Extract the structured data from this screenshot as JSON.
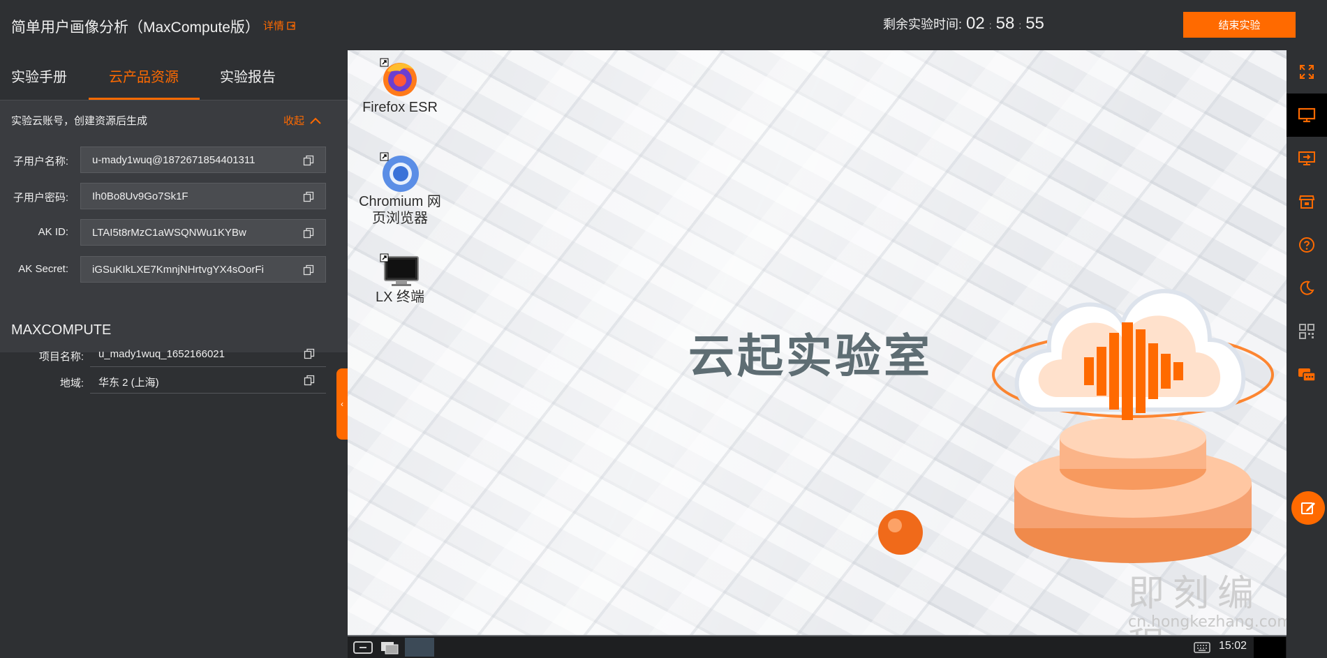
{
  "header": {
    "title": "简单用户画像分析（MaxCompute版）",
    "details_label": "详情",
    "timer_label": "剩余实验时间:",
    "timer_hours": "02",
    "timer_minutes": "58",
    "timer_seconds": "55",
    "timer_sep": ":",
    "end_button": "结束实验"
  },
  "tabs": [
    {
      "label": "实验手册",
      "active": false
    },
    {
      "label": "云产品资源",
      "active": true
    },
    {
      "label": "实验报告",
      "active": false
    }
  ],
  "account": {
    "heading": "实验云账号，创建资源后生成",
    "collapse_label": "收起",
    "fields": [
      {
        "label": "子用户名称:",
        "value": "u-mady1wuq@1872671854401311"
      },
      {
        "label": "子用户密码:",
        "value": "Ih0Bo8Uv9Go7Sk1F"
      },
      {
        "label": "AK ID:",
        "value": "LTAI5t8rMzC1aWSQNWu1KYBw"
      },
      {
        "label": "AK Secret:",
        "value": "iGSuKIkLXE7KmnjNHrtvgYX4sOorFi"
      }
    ]
  },
  "maxcompute": {
    "title": "MAXCOMPUTE",
    "fields": [
      {
        "label": "项目名称:",
        "value": "u_mady1wuq_1652166021"
      },
      {
        "label": "地域:",
        "value": "华东 2 (上海)"
      }
    ]
  },
  "desktop": {
    "icons": [
      {
        "label": "Firefox ESR",
        "icon": "firefox-icon"
      },
      {
        "label": "Chromium 网页浏览器",
        "icon": "chromium-icon"
      },
      {
        "label": "LX 终端",
        "icon": "terminal-icon"
      }
    ],
    "brand_text": "云起实验室",
    "watermark": "即刻编程",
    "watermark_url": "cn.hongkezhang.com"
  },
  "taskbar": {
    "clock": "15:02"
  },
  "rail": {
    "items": [
      "fullscreen-icon",
      "monitor-icon",
      "remote-desktop-icon",
      "store-icon",
      "help-icon",
      "dark-mode-icon",
      "qrcode-icon",
      "chat-icon"
    ],
    "active_index": 1
  },
  "colors": {
    "accent": "#ff6a00",
    "panel_bg": "#2e3033",
    "field_bg": "#4a4c50"
  }
}
